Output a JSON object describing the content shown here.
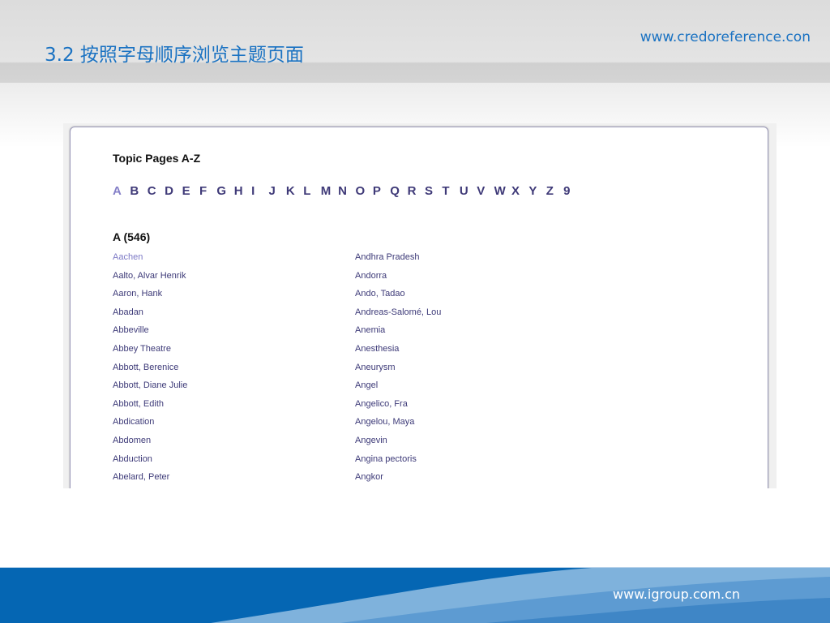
{
  "slide": {
    "title": "3.2 按照字母顺序浏览主题页面",
    "site_url": "www.credoreference.con",
    "footer_url": "www.igroup.com.cn"
  },
  "page": {
    "heading": "Topic Pages A-Z",
    "letters": [
      "A",
      "B",
      "C",
      "D",
      "E",
      "F",
      "G",
      "H",
      "I",
      "J",
      "K",
      "L",
      "M",
      "N",
      "O",
      "P",
      "Q",
      "R",
      "S",
      "T",
      "U",
      "V",
      "W",
      "X",
      "Y",
      "Z",
      "9"
    ],
    "section": "A (546)",
    "column1": [
      "Aachen",
      "Aalto, Alvar Henrik",
      "Aaron, Hank",
      "Abadan",
      "Abbeville",
      "Abbey Theatre",
      "Abbott, Berenice",
      "Abbott, Diane Julie",
      "Abbott, Edith",
      "Abdication",
      "Abdomen",
      "Abduction",
      "Abelard, Peter"
    ],
    "column2": [
      "Andhra Pradesh",
      "Andorra",
      "Ando, Tadao",
      "Andreas-Salomé, Lou",
      "Anemia",
      "Anesthesia",
      "Aneurysm",
      "Angel",
      "Angelico, Fra",
      "Angelou, Maya",
      "Angevin",
      "Angina pectoris",
      "Angkor"
    ]
  }
}
